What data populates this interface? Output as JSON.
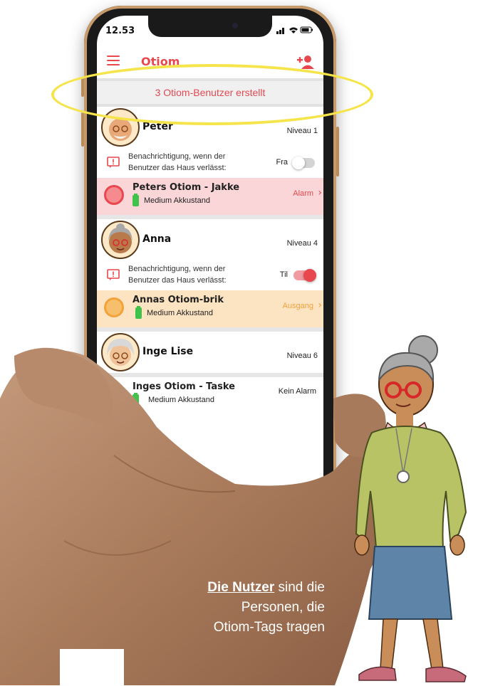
{
  "status_bar": {
    "time": "12.53",
    "icons": "▲ ⌁ ▮"
  },
  "app": {
    "title": "Otiom",
    "menu_icon": "menu-icon",
    "add_user_icon": "add-user-icon"
  },
  "banner": {
    "text": "3 Otiom-Benutzer erstellt"
  },
  "users": [
    {
      "name": "Peter",
      "level": "Niveau 1",
      "notify_text": "Benachrichtigung, wenn der Benutzer das Haus verlässt:",
      "toggle_label": "Fra",
      "toggle_on": false,
      "tag": {
        "name": "Peters Otiom - Jakke",
        "battery": "Medium Akkustand",
        "state": "Alarm",
        "state_color": "#e8474e",
        "row_bg": "#fbd6d8",
        "dot_color": "#e8474e"
      }
    },
    {
      "name": "Anna",
      "level": "Niveau 4",
      "notify_text": "Benachrichtigung, wenn der Benutzer das Haus verlässt:",
      "toggle_label": "Til",
      "toggle_on": true,
      "tag": {
        "name": "Annas Otiom-brik",
        "battery": "Medium Akkustand",
        "state": "Ausgang",
        "state_color": "#f2a33a",
        "row_bg": "#fce3c2",
        "dot_color": "#f2a33a"
      }
    },
    {
      "name": "Inge Lise",
      "level": "Niveau 6",
      "tag": {
        "name": "Inges Otiom - Taske",
        "battery": "Medium Akkustand",
        "state": "Kein Alarm",
        "state_color": "#222222",
        "row_bg": "#ffffff",
        "dot_color": "#41c24a"
      }
    }
  ],
  "caption": {
    "strong": "Die Nutzer",
    "rest1": " sind die",
    "line2": "Personen, die",
    "line3": "Otiom-Tags tragen"
  },
  "colors": {
    "accent": "#e8474e",
    "highlight": "#f5e44a",
    "ok": "#41c24a"
  }
}
